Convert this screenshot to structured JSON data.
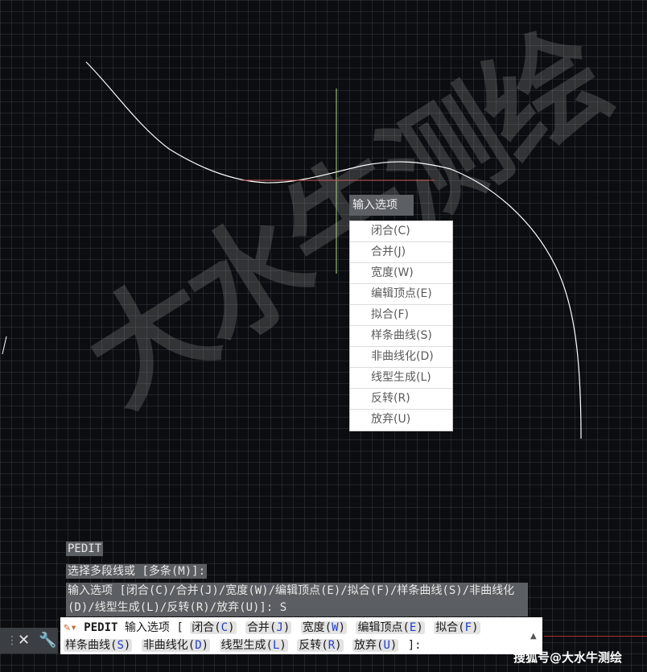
{
  "watermark": "大水牛测绘",
  "tooltip_title": "输入选项",
  "menu": [
    "闭合(C)",
    "合并(J)",
    "宽度(W)",
    "编辑顶点(E)",
    "拟合(F)",
    "样条曲线(S)",
    "非曲线化(D)",
    "线型生成(L)",
    "反转(R)",
    "放弃(U)"
  ],
  "history": {
    "line1": "PEDIT",
    "line2": "选择多段线或 [多条(M)]:",
    "line3": "输入选项 [闭合(C)/合并(J)/宽度(W)/编辑顶点(E)/拟合(F)/样条曲线(S)/非曲线化(D)/线型生成(L)/反转(R)/放弃(U)]: S"
  },
  "command_line": {
    "command": "PEDIT",
    "prompt": "输入选项 [",
    "options_row1": [
      {
        "label": "闭合(",
        "key": "C",
        "end": ")"
      },
      {
        "label": "合并(",
        "key": "J",
        "end": ")"
      },
      {
        "label": "宽度(",
        "key": "W",
        "end": ")"
      },
      {
        "label": "编辑顶点(",
        "key": "E",
        "end": ")"
      },
      {
        "label": "拟合(",
        "key": "F",
        "end": ")"
      }
    ],
    "options_row2": [
      {
        "label": "样条曲线(",
        "key": "S",
        "end": ")"
      },
      {
        "label": "非曲线化(",
        "key": "D",
        "end": ")"
      },
      {
        "label": "线型生成(",
        "key": "L",
        "end": ")"
      },
      {
        "label": "反转(",
        "key": "R",
        "end": ")"
      },
      {
        "label": "放弃(",
        "key": "U",
        "end": ")"
      }
    ],
    "suffix": "]:"
  },
  "credit": "搜狐号@大水牛测绘",
  "icons": {
    "close": "close-icon",
    "customize": "wrench-icon",
    "recent": "pencil-dropdown-icon"
  },
  "colors": {
    "canvas": "#0b0d10",
    "curve": "#ffffff",
    "crosshair": "#b5d98a",
    "option_key": "#1e3cc8"
  }
}
